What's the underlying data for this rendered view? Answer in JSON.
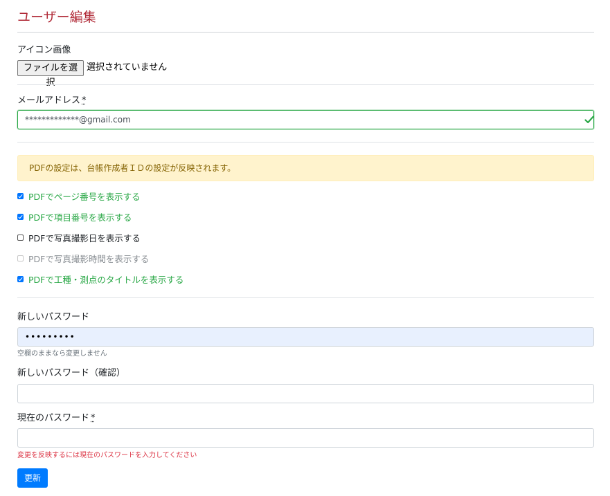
{
  "page": {
    "title": "ユーザー編集"
  },
  "icon_image": {
    "label": "アイコン画像",
    "button_label": "ファイルを選択",
    "status": "選択されていません"
  },
  "email": {
    "label": "メールアドレス",
    "required_mark": "*",
    "value": "*************@gmail.com"
  },
  "pdf": {
    "notice": "PDFの設定は、台帳作成者ＩＤの設定が反映されます。",
    "options": [
      {
        "label": "PDFでページ番号を表示する",
        "checked": true,
        "disabled": false
      },
      {
        "label": "PDFで項目番号を表示する",
        "checked": true,
        "disabled": false
      },
      {
        "label": "PDFで写真撮影日を表示する",
        "checked": false,
        "disabled": false
      },
      {
        "label": "PDFで写真撮影時間を表示する",
        "checked": false,
        "disabled": true
      },
      {
        "label": "PDFで工種・測点のタイトルを表示する",
        "checked": true,
        "disabled": false
      }
    ]
  },
  "new_password": {
    "label": "新しいパスワード",
    "value": "•••••••••",
    "help": "空欄のままなら変更しません"
  },
  "confirm_password": {
    "label": "新しいパスワード（確認）",
    "value": ""
  },
  "current_password": {
    "label": "現在のパスワード",
    "required_mark": "*",
    "value": "",
    "help": "変更を反映するには現在のパスワードを入力してください"
  },
  "submit": {
    "label": "更新"
  },
  "colors": {
    "title": "#b02a37",
    "valid": "#28a745",
    "primary": "#007bff",
    "warning_bg": "#fff3cd",
    "danger": "#dc3545"
  }
}
